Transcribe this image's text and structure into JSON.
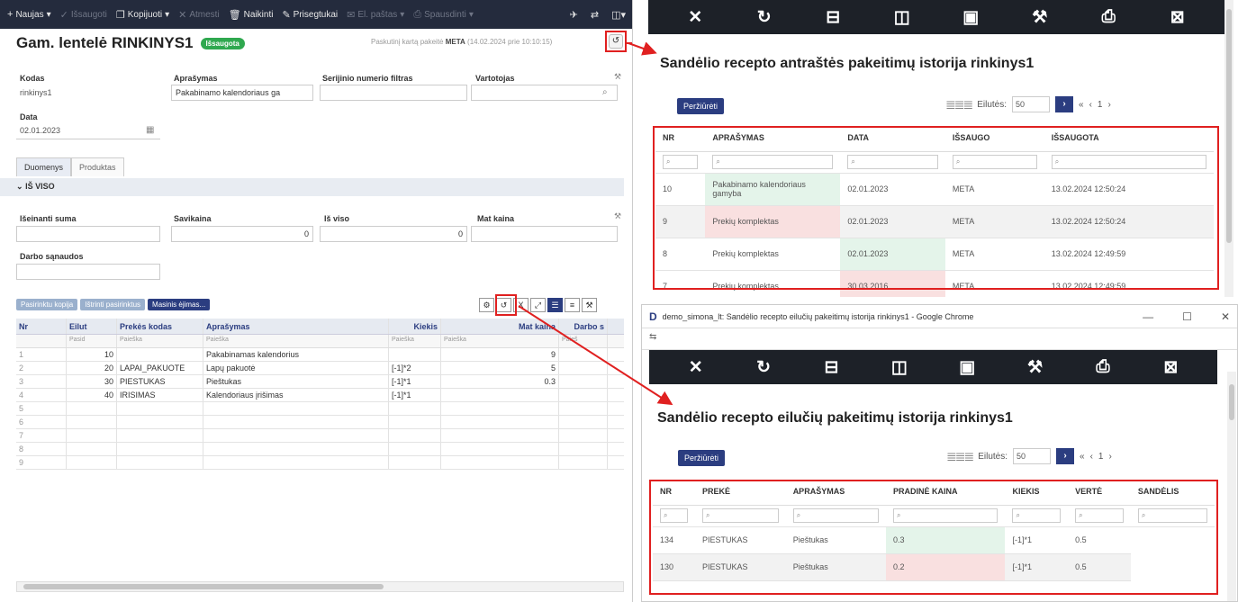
{
  "left": {
    "toolbar": [
      {
        "icon": "+",
        "label": "Naujas",
        "dim": false,
        "caret": true
      },
      {
        "icon": "✓",
        "label": "Išsaugoti",
        "dim": true,
        "caret": false
      },
      {
        "icon": "❐",
        "label": "Kopijuoti",
        "dim": false,
        "caret": true
      },
      {
        "icon": "✕",
        "label": "Atmesti",
        "dim": true,
        "caret": false
      },
      {
        "icon": "🗑",
        "label": "Naikinti",
        "dim": false,
        "caret": false
      },
      {
        "icon": "✎",
        "label": "Prisegtukai",
        "dim": false,
        "caret": false
      },
      {
        "icon": "✉",
        "label": "El. paštas",
        "dim": true,
        "caret": true
      },
      {
        "icon": "⎙",
        "label": "Spausdinti",
        "dim": true,
        "caret": true
      }
    ],
    "title": "Gam. lentelė RINKINYS1",
    "status_badge": "Išsaugota",
    "last_change_prefix": "Paskutinį kartą pakeitė",
    "last_change_user": "META",
    "last_change_when": "(14.02.2024 prie 10:10:15)",
    "history_icon": "↺",
    "fields": {
      "kodas_label": "Kodas",
      "kodas_value": "rinkinys1",
      "aprasymas_label": "Aprašymas",
      "aprasymas_value": "Pakabinamo kalendoriaus ga",
      "serial_label": "Serijinio numerio filtras",
      "serial_value": "",
      "user_label": "Vartotojas",
      "user_value": "",
      "data_label": "Data",
      "data_value": "02.01.2023"
    },
    "tabs": [
      "Duomenys",
      "Produktas"
    ],
    "section_title": "IŠ VISO",
    "totals": {
      "out_label": "Išeinanti suma",
      "out_value": "",
      "cost_label": "Savikaina",
      "cost_value": "0",
      "total_label": "Iš viso",
      "total_value": "0",
      "mat_label": "Mat kaina",
      "mat_value": "",
      "work_label": "Darbo sąnaudos",
      "work_value": ""
    },
    "buttons": {
      "copy_rows": "Pasirinktu kopija",
      "delete_rows": "Ištrinti pasirinktus",
      "mass_edit": "Masinis ėjimas..."
    },
    "grid": {
      "headers": [
        "Nr",
        "Eilut",
        "Prekės kodas",
        "Aprašymas",
        "Kiekis",
        "Mat kaina",
        "Darbo s"
      ],
      "filters": [
        "",
        "Pasid",
        "Paieška",
        "Paieška",
        "Paieška",
        "Paieška",
        "Paieš"
      ],
      "rows": [
        {
          "n": "1",
          "e": "10",
          "code": "",
          "desc": "Pakabinamas kalendorius",
          "qty": "",
          "mat": "9"
        },
        {
          "n": "2",
          "e": "20",
          "code": "LAPAI_PAKUOTE",
          "desc": "Lapų pakuotė",
          "qty": "[-1]*2",
          "mat": "5"
        },
        {
          "n": "3",
          "e": "30",
          "code": "PIESTUKAS",
          "desc": "Pieštukas",
          "qty": "[-1]*1",
          "mat": "0.3"
        },
        {
          "n": "4",
          "e": "40",
          "code": "IRISIMAS",
          "desc": "Kalendoriaus įrišimas",
          "qty": "[-1]*1",
          "mat": ""
        },
        {
          "n": "5",
          "e": "",
          "code": "",
          "desc": "",
          "qty": "",
          "mat": ""
        },
        {
          "n": "6",
          "e": "",
          "code": "",
          "desc": "",
          "qty": "",
          "mat": ""
        },
        {
          "n": "7",
          "e": "",
          "code": "",
          "desc": "",
          "qty": "",
          "mat": ""
        },
        {
          "n": "8",
          "e": "",
          "code": "",
          "desc": "",
          "qty": "",
          "mat": ""
        },
        {
          "n": "9",
          "e": "",
          "code": "",
          "desc": "",
          "qty": "",
          "mat": ""
        }
      ]
    }
  },
  "top_window": {
    "title": "Sandėlio recepto antraštės pakeitimų istorija rinkinys1",
    "view_button": "Peržiūrėti",
    "rows_label": "Eilutės:",
    "rows_value": "50",
    "page": "1",
    "headers": [
      "NR",
      "APRAŠYMAS",
      "DATA",
      "IŠSAUGO",
      "IŠSAUGOTA"
    ],
    "rows": [
      {
        "nr": "10",
        "desc": "Pakabinamo kalendoriaus gamyba",
        "date": "02.01.2023",
        "by": "META",
        "when": "13.02.2024 12:50:24"
      },
      {
        "nr": "9",
        "desc": "Prekių komplektas",
        "date": "02.01.2023",
        "by": "META",
        "when": "13.02.2024 12:50:24"
      },
      {
        "nr": "8",
        "desc": "Prekių komplektas",
        "date": "02.01.2023",
        "by": "META",
        "when": "13.02.2024 12:49:59"
      },
      {
        "nr": "7",
        "desc": "Prekių komplektas",
        "date": "30.03.2016",
        "by": "META",
        "when": "13.02.2024 12:49:59"
      }
    ]
  },
  "bottom_window": {
    "chrome_title": "demo_simona_lt: Sandėlio recepto eilučių pakeitimų istorija rinkinys1 - Google Chrome",
    "title": "Sandėlio recepto eilučių pakeitimų istorija rinkinys1",
    "view_button": "Peržiūrėti",
    "rows_label": "Eilutės:",
    "rows_value": "50",
    "page": "1",
    "headers": [
      "NR",
      "PREKĖ",
      "APRAŠYMAS",
      "PRADINĖ KAINA",
      "KIEKIS",
      "VERTĖ",
      "SANDĖLIS"
    ],
    "rows": [
      {
        "nr": "134",
        "item": "PIESTUKAS",
        "desc": "Pieštukas",
        "price": "0.3",
        "qty": "[-1]*1",
        "val": "0.5"
      },
      {
        "nr": "130",
        "item": "PIESTUKAS",
        "desc": "Pieštukas",
        "price": "0.2",
        "qty": "[-1]*1",
        "val": "0.5"
      }
    ]
  },
  "colors": {
    "accent": "#2b3d80",
    "highlight": "#e02020",
    "green": "#2fa84f",
    "toolbar": "#242b3d",
    "dark": "#1d2128"
  }
}
